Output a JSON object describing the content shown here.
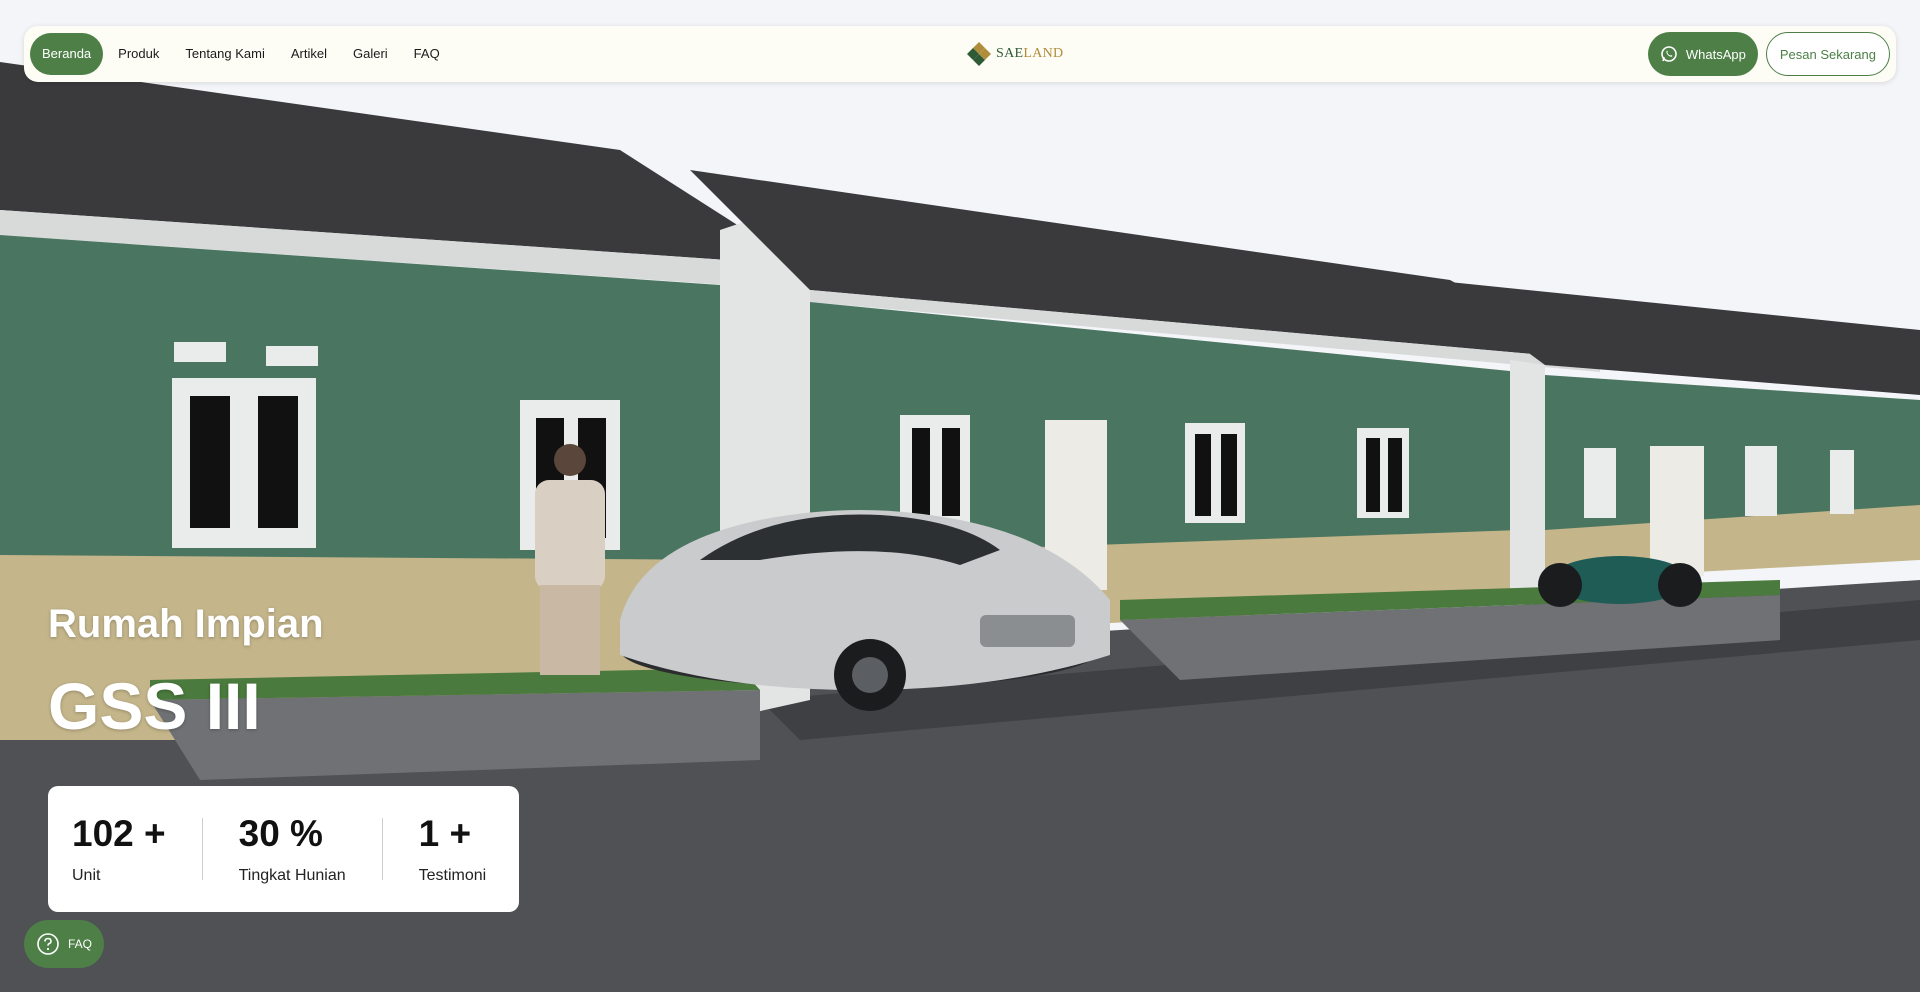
{
  "nav": {
    "items": [
      {
        "label": "Beranda",
        "active": true
      },
      {
        "label": "Produk"
      },
      {
        "label": "Tentang Kami"
      },
      {
        "label": "Artikel"
      },
      {
        "label": "Galeri"
      },
      {
        "label": "FAQ"
      }
    ],
    "logo": {
      "part1": "SAE",
      "part2": "LAND"
    },
    "whatsapp_label": "WhatsApp",
    "order_label": "Pesan Sekarang"
  },
  "hero": {
    "subtitle": "Rumah Impian",
    "title": "GSS III"
  },
  "stats": [
    {
      "value": "102 +",
      "label": "Unit"
    },
    {
      "value": "30 %",
      "label": "Tingkat Hunian"
    },
    {
      "value": "1 +",
      "label": "Testimoni"
    }
  ],
  "faq_button": {
    "label": "FAQ"
  },
  "colors": {
    "brand_green": "#4d7f47",
    "gold": "#b08d3a",
    "wall_green": "#4a7560"
  }
}
